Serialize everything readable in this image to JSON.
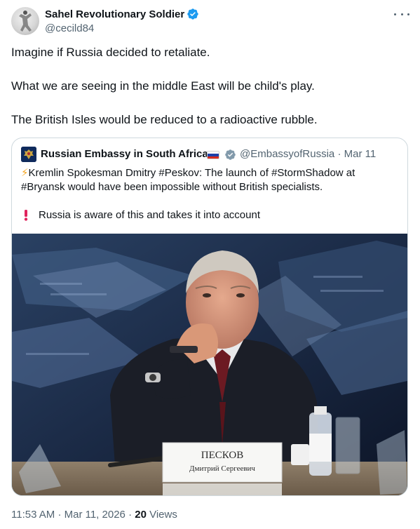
{
  "author": {
    "name": "Sahel Revolutionary Soldier",
    "handle": "@cecild84"
  },
  "tweet": {
    "line1": "Imagine if Russia decided to retaliate.",
    "line2": "What we are seeing in the middle East will be child's play.",
    "line3": "The British Isles would be reduced to a radioactive rubble."
  },
  "quoted": {
    "name": "Russian Embassy in South Africa",
    "handle": "@EmbassyofRussia",
    "separator": "·",
    "date": "Mar 11",
    "text_line1": "Kremlin Spokesman Dmitry #Peskov: The launch of #StormShadow at",
    "text_line2": "#Bryansk would have been impossible without British specialists.",
    "text_line3": "Russia is aware of this and takes it into account",
    "bolt": "⚡",
    "photo": {
      "nameplate_line1": "ПЕСКОВ",
      "nameplate_line2": "Дмитрий Сергеевич"
    }
  },
  "meta": {
    "time": "11:53 AM",
    "separator1": "·",
    "date": "Mar 11, 2026",
    "separator2": "·",
    "views_count": "20",
    "views_label": "Views"
  },
  "colors": {
    "verified_blue": "#1d9bf0",
    "gray_badge": "#829aab",
    "alert_red": "#e0245e",
    "muted_text": "#536471"
  },
  "icons": {
    "verified": "verified-badge-icon",
    "more": "more-icon",
    "alert": "exclamation-icon"
  }
}
